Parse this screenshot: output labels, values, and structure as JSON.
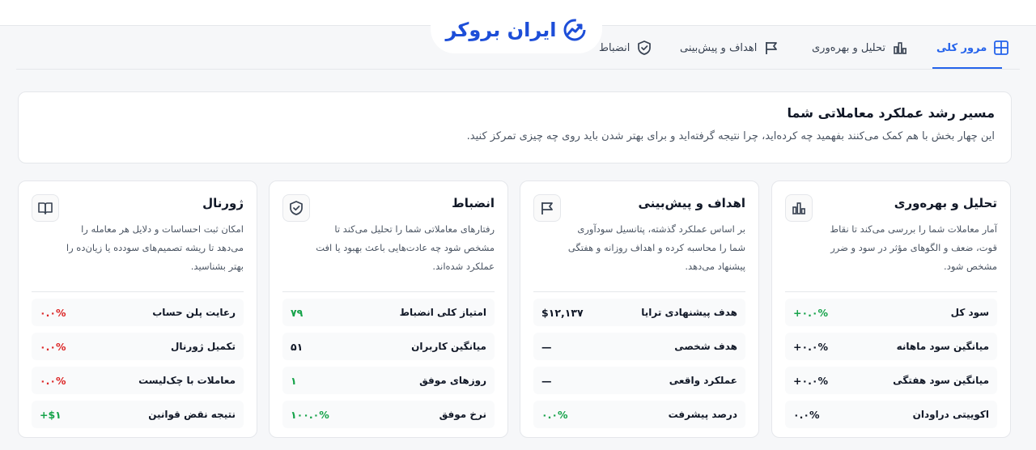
{
  "brand": {
    "name": "ایران بروکر",
    "accent": "#2563eb",
    "logo_color": "#1d4ed8"
  },
  "tabs": [
    {
      "label": "مرور کلی",
      "icon": "grid-icon",
      "active": true
    },
    {
      "label": "تحلیل و بهره‌وری",
      "icon": "bar-chart-icon",
      "active": false
    },
    {
      "label": "اهداف و پیش‌بینی",
      "icon": "flag-icon",
      "active": false
    },
    {
      "label": "انضباط",
      "icon": "shield-check-icon",
      "active": false
    }
  ],
  "intro": {
    "title": "مسیر رشد عملکرد معاملاتی شما",
    "description": "این چهار بخش با هم کمک می‌کنند بفهمید چه کرده‌اید، چرا نتیجه گرفته‌اید و برای بهتر شدن باید روی چه چیزی تمرکز کنید."
  },
  "cards": [
    {
      "title": "تحلیل و بهره‌وری",
      "icon": "bar-chart-icon",
      "description": "آمار معاملات شما را بررسی می‌کند تا نقاط قوت، ضعف و الگوهای مؤثر در سود و ضرر مشخص شود.",
      "rows": [
        {
          "label": "سود کل",
          "value": "+۰.۰%",
          "tone": "green"
        },
        {
          "label": "میانگین سود ماهانه",
          "value": "+۰.۰%",
          "tone": "dark"
        },
        {
          "label": "میانگین سود هفتگی",
          "value": "+۰.۰%",
          "tone": "dark"
        },
        {
          "label": "اکوییتی دراودان",
          "value": "۰.۰%",
          "tone": "dark"
        }
      ]
    },
    {
      "title": "اهداف و پیش‌بینی",
      "icon": "flag-icon",
      "description": "بر اساس عملکرد گذشته، پتانسیل سودآوری شما را محاسبه کرده و اهداف روزانه و هفتگی پیشنهاد می‌دهد.",
      "rows": [
        {
          "label": "هدف پیشنهادی ترایا",
          "value": "$۱۲,۱۳۷",
          "tone": "dark"
        },
        {
          "label": "هدف شخصی",
          "value": "—",
          "tone": "dark"
        },
        {
          "label": "عملکرد واقعی",
          "value": "—",
          "tone": "dark"
        },
        {
          "label": "درصد پیشرفت",
          "value": "۰.۰%",
          "tone": "green"
        }
      ]
    },
    {
      "title": "انضباط",
      "icon": "shield-check-icon",
      "description": "رفتارهای معاملاتی شما را تحلیل می‌کند تا مشخص شود چه عادت‌هایی باعث بهبود یا افت عملکرد شده‌اند.",
      "rows": [
        {
          "label": "امتیاز کلی انضباط",
          "value": "۷۹",
          "tone": "green"
        },
        {
          "label": "میانگین کاربران",
          "value": "۵۱",
          "tone": "dark"
        },
        {
          "label": "روزهای موفق",
          "value": "۱",
          "tone": "green"
        },
        {
          "label": "نرخ موفق",
          "value": "۱۰۰.۰%",
          "tone": "green"
        }
      ]
    },
    {
      "title": "ژورنال",
      "icon": "book-icon",
      "description": "امکان ثبت احساسات و دلایل هر معامله را می‌دهد تا ریشه تصمیم‌های سودده یا زیان‌ده را بهتر بشناسید.",
      "rows": [
        {
          "label": "رعایت پلن حساب",
          "value": "۰.۰%",
          "tone": "red"
        },
        {
          "label": "تکمیل ژورنال",
          "value": "۰.۰%",
          "tone": "red"
        },
        {
          "label": "معاملات با چک‌لیست",
          "value": "۰.۰%",
          "tone": "red"
        },
        {
          "label": "نتیجه نقض قوانین",
          "value": "+$۱",
          "tone": "green"
        }
      ]
    }
  ]
}
